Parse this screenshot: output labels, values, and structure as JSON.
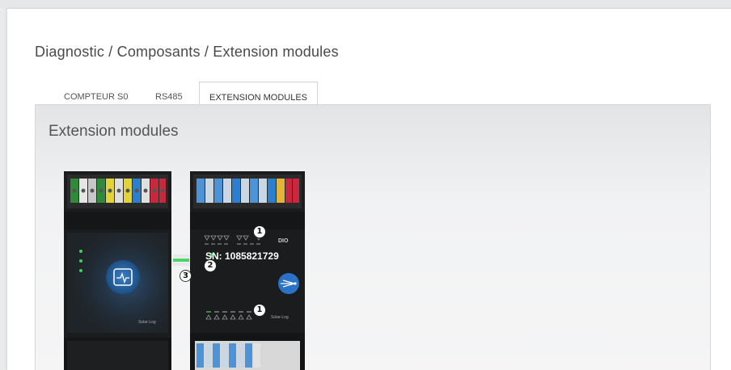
{
  "breadcrumb": "Diagnostic / Composants / Extension modules",
  "tabs": [
    {
      "label": "COMPTEUR S0"
    },
    {
      "label": "RS485"
    },
    {
      "label": "EXTENSION MODULES"
    }
  ],
  "panel": {
    "title": "Extension modules",
    "serial": "SN: 1085821729",
    "dio_label": "DIO",
    "badges": [
      "1",
      "2",
      "1",
      "3"
    ]
  }
}
